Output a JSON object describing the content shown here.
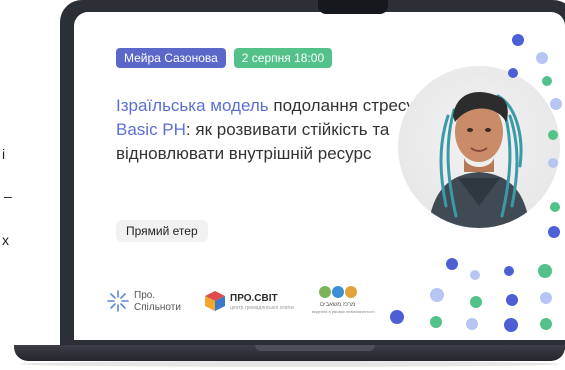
{
  "left_overlay": {
    "line1": "і",
    "line2": "–",
    "line3": "х"
  },
  "event": {
    "author": "Мейра Сазонова",
    "date": "2 серпня 18:00",
    "title_parts": [
      {
        "text": "Ізраїльська модель",
        "accent": true
      },
      {
        "text": " подолання стресу ",
        "accent": false
      },
      {
        "text": "Basic PH",
        "accent": true
      },
      {
        "text": ": як розвивати стійкість та відновлювати внутрішній ресурс",
        "accent": false
      }
    ],
    "live_label": "Прямий етер"
  },
  "logos": {
    "pro_spilnoty": {
      "line1": "Про.",
      "line2": "Спільноти"
    },
    "pro_svit": {
      "name": "ПРО.СВІТ",
      "tagline": "центр громадянської освіти"
    },
    "third": {
      "line1": "מרכז משאבים",
      "line2": "ведення в умовах невизначеності"
    }
  },
  "colors": {
    "accent_blue": "#5b6fd6",
    "badge_blue": "#5b67c9",
    "badge_green": "#52c28a"
  }
}
